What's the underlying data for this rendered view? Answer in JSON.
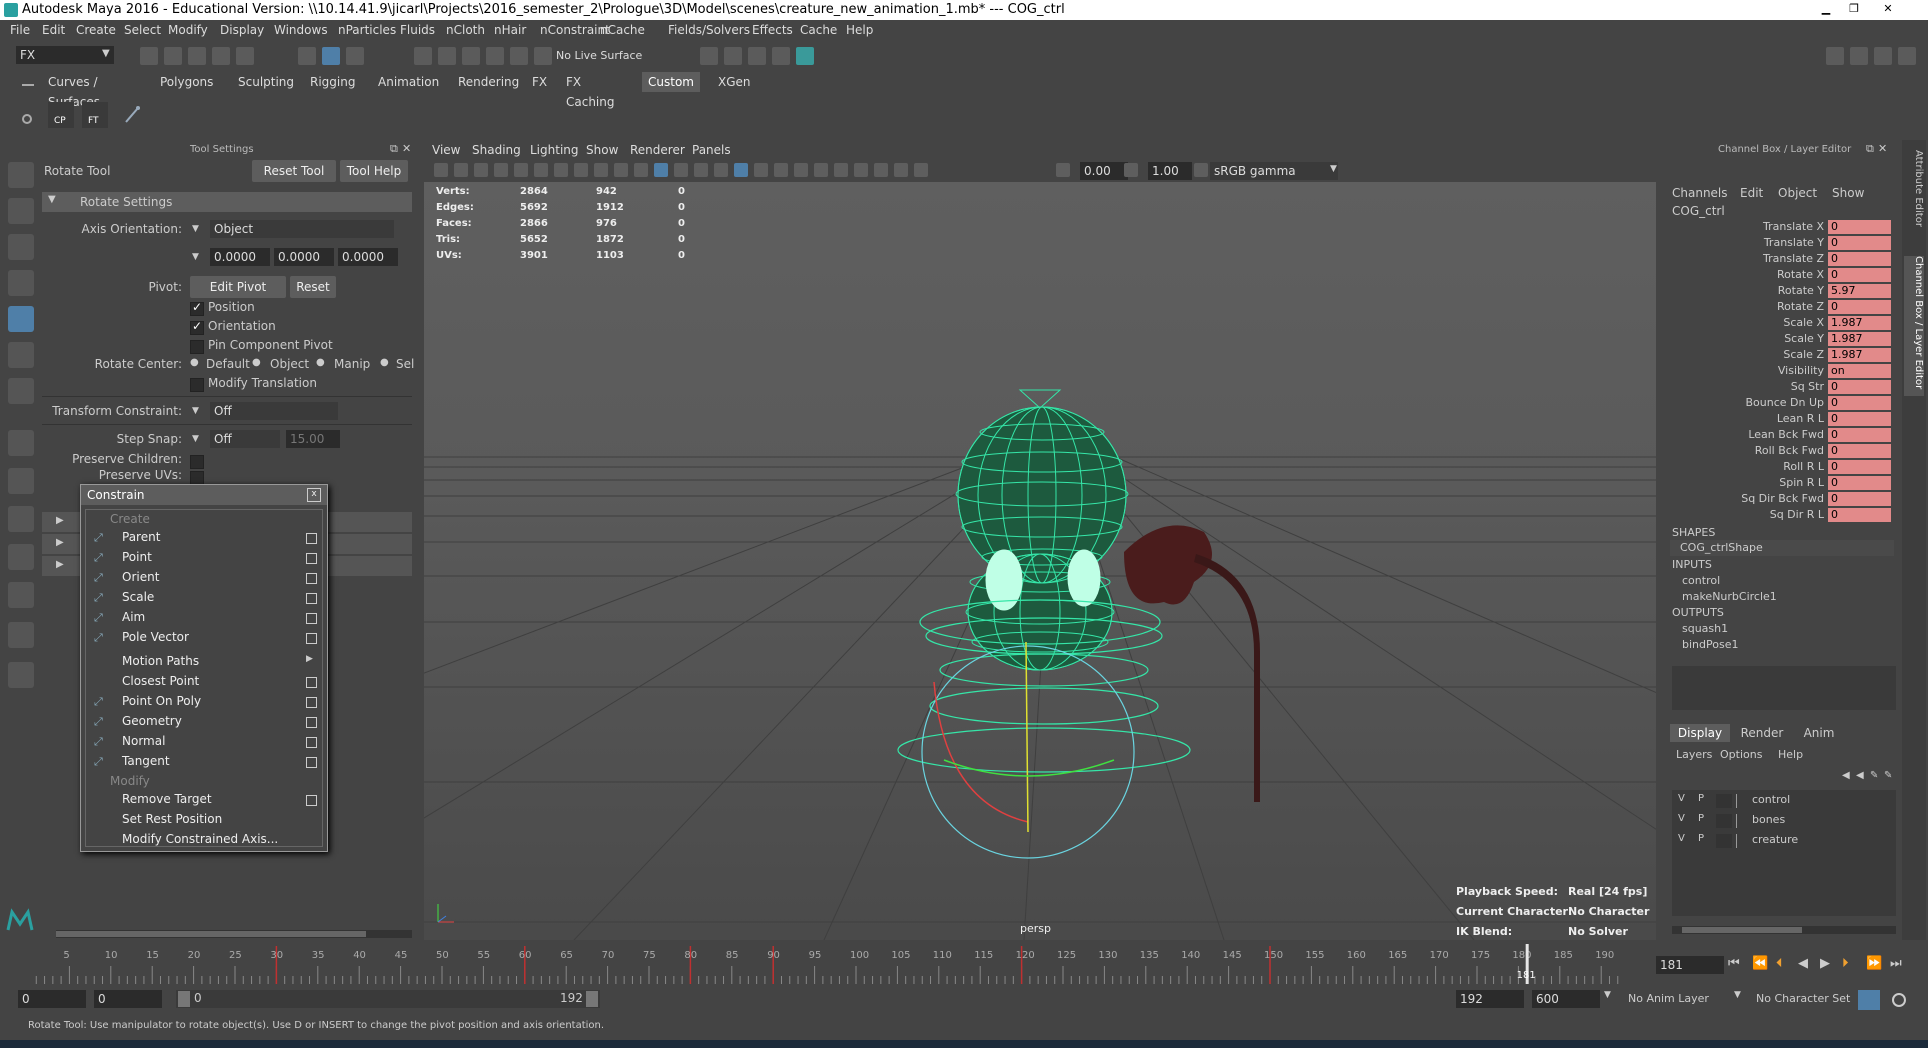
{
  "title": "Autodesk Maya 2016 - Educational Version: \\\\10.14.41.9\\jicarl\\Projects\\2016_semester_2\\Prologue\\3D\\Model\\scenes\\creature_new_animation_1.mb*   ---   COG_ctrl",
  "menus": [
    "File",
    "Edit",
    "Create",
    "Select",
    "Modify",
    "Display",
    "Windows",
    "nParticles",
    "Fluids",
    "nCloth",
    "nHair",
    "nConstraint",
    "nCache",
    "Fields/Solvers",
    "Effects",
    "Cache",
    "Help"
  ],
  "toolbar": {
    "mode": "FX",
    "live_surface": "No Live Surface"
  },
  "shelf_tabs": [
    "Curves / Surfaces",
    "Polygons",
    "Sculpting",
    "Rigging",
    "Animation",
    "Rendering",
    "FX",
    "FX Caching",
    "Custom",
    "XGen"
  ],
  "shelf_active": "Custom",
  "shelf_icons": {
    "cp": "CP",
    "ft": "FT"
  },
  "tool_settings": {
    "panel_title": "Tool Settings",
    "tool_name": "Rotate Tool",
    "reset_tool": "Reset Tool",
    "tool_help": "Tool Help",
    "section": "Rotate Settings",
    "axis_orientation_label": "Axis Orientation:",
    "axis_orientation_value": "Object",
    "axis_x": "0.0000",
    "axis_y": "0.0000",
    "axis_z": "0.0000",
    "pivot_label": "Pivot:",
    "edit_pivot": "Edit Pivot",
    "reset": "Reset",
    "position": "Position",
    "orientation": "Orientation",
    "pin_component_pivot": "Pin Component Pivot",
    "rotate_center_label": "Rotate Center:",
    "rc_default": "Default",
    "rc_object": "Object",
    "rc_manip": "Manip",
    "rc_sel": "Sel",
    "modify_translation": "Modify Translation",
    "transform_constraint_label": "Transform Constraint:",
    "transform_constraint_value": "Off",
    "step_snap_label": "Step Snap:",
    "step_snap_value": "Off",
    "step_snap_amount": "15.00",
    "preserve_children": "Preserve Children:",
    "preserve_uvs": "Preserve UVs:"
  },
  "constrain_menu": {
    "title": "Constrain",
    "create_header": "Create",
    "create_items": [
      "Parent",
      "Point",
      "Orient",
      "Scale",
      "Aim",
      "Pole Vector"
    ],
    "motion_paths": "Motion Paths",
    "more_items": [
      "Closest Point",
      "Point On Poly",
      "Geometry",
      "Normal",
      "Tangent"
    ],
    "modify_header": "Modify",
    "modify_items": [
      "Remove Target",
      "Set Rest Position",
      "Modify Constrained Axis..."
    ],
    "close": "x"
  },
  "viewport": {
    "menus": [
      "View",
      "Shading",
      "Lighting",
      "Show",
      "Renderer",
      "Panels"
    ],
    "field_a": "0.00",
    "field_b": "1.00",
    "color_space": "sRGB gamma",
    "stats": [
      {
        "label": "Verts:",
        "a": "2864",
        "b": "942",
        "c": "0"
      },
      {
        "label": "Edges:",
        "a": "5692",
        "b": "1912",
        "c": "0"
      },
      {
        "label": "Faces:",
        "a": "2866",
        "b": "976",
        "c": "0"
      },
      {
        "label": "Tris:",
        "a": "5652",
        "b": "1872",
        "c": "0"
      },
      {
        "label": "UVs:",
        "a": "3901",
        "b": "1103",
        "c": "0"
      }
    ],
    "camera": "persp",
    "playback_speed_label": "Playback Speed:",
    "playback_speed": "Real [24 fps]",
    "current_character_label": "Current Character:",
    "current_character": "No Character",
    "ik_blend_label": "IK Blend:",
    "ik_blend": "No Solver"
  },
  "channel_box": {
    "title": "Channel Box / Layer Editor",
    "menus": [
      "Channels",
      "Edit",
      "Object",
      "Show"
    ],
    "object": "COG_ctrl",
    "attrs": [
      {
        "name": "Translate X",
        "value": "0"
      },
      {
        "name": "Translate Y",
        "value": "0"
      },
      {
        "name": "Translate Z",
        "value": "0"
      },
      {
        "name": "Rotate X",
        "value": "0"
      },
      {
        "name": "Rotate Y",
        "value": "5.97"
      },
      {
        "name": "Rotate Z",
        "value": "0"
      },
      {
        "name": "Scale X",
        "value": "1.987"
      },
      {
        "name": "Scale Y",
        "value": "1.987"
      },
      {
        "name": "Scale Z",
        "value": "1.987"
      },
      {
        "name": "Visibility",
        "value": "on"
      },
      {
        "name": "Sq Str",
        "value": "0"
      },
      {
        "name": "Bounce Dn Up",
        "value": "0"
      },
      {
        "name": "Lean R L",
        "value": "0"
      },
      {
        "name": "Lean Bck Fwd",
        "value": "0"
      },
      {
        "name": "Roll Bck Fwd",
        "value": "0"
      },
      {
        "name": "Roll R L",
        "value": "0"
      },
      {
        "name": "Spin R L",
        "value": "0"
      },
      {
        "name": "Sq Dir Bck Fwd",
        "value": "0"
      },
      {
        "name": "Sq Dir R L",
        "value": "0"
      }
    ],
    "shapes_header": "SHAPES",
    "shape": "COG_ctrlShape",
    "inputs_header": "INPUTS",
    "inputs": [
      "control",
      "makeNurbCircle1"
    ],
    "outputs_header": "OUTPUTS",
    "outputs": [
      "squash1",
      "bindPose1"
    ],
    "layer_tabs": [
      "Display",
      "Render",
      "Anim"
    ],
    "layer_menus": [
      "Layers",
      "Options",
      "Help"
    ],
    "layers": [
      {
        "v": "V",
        "p": "P",
        "name": "control"
      },
      {
        "v": "V",
        "p": "P",
        "name": "bones"
      },
      {
        "v": "V",
        "p": "P",
        "name": "creature"
      }
    ],
    "side_tabs": [
      "Attribute Editor",
      "Channel Box / Layer Editor"
    ]
  },
  "timeline": {
    "ticks": [
      "5",
      "10",
      "15",
      "20",
      "25",
      "30",
      "35",
      "40",
      "45",
      "50",
      "55",
      "60",
      "65",
      "70",
      "75",
      "80",
      "85",
      "90",
      "95",
      "100",
      "105",
      "110",
      "115",
      "120",
      "125",
      "130",
      "135",
      "140",
      "145",
      "150",
      "155",
      "160",
      "165",
      "170",
      "175",
      "180",
      "185",
      "190"
    ],
    "current_frame_marker": "181",
    "current_frame_field": "181"
  },
  "range": {
    "start": "0",
    "anim_start": "0",
    "range_start": "0",
    "range_end": "192",
    "end": "192",
    "anim_end": "600",
    "anim_layer": "No Anim Layer",
    "char_set": "No Character Set"
  },
  "status": "Rotate Tool: Use manipulator to rotate object(s). Use D or INSERT to change the pivot position and axis orientation."
}
